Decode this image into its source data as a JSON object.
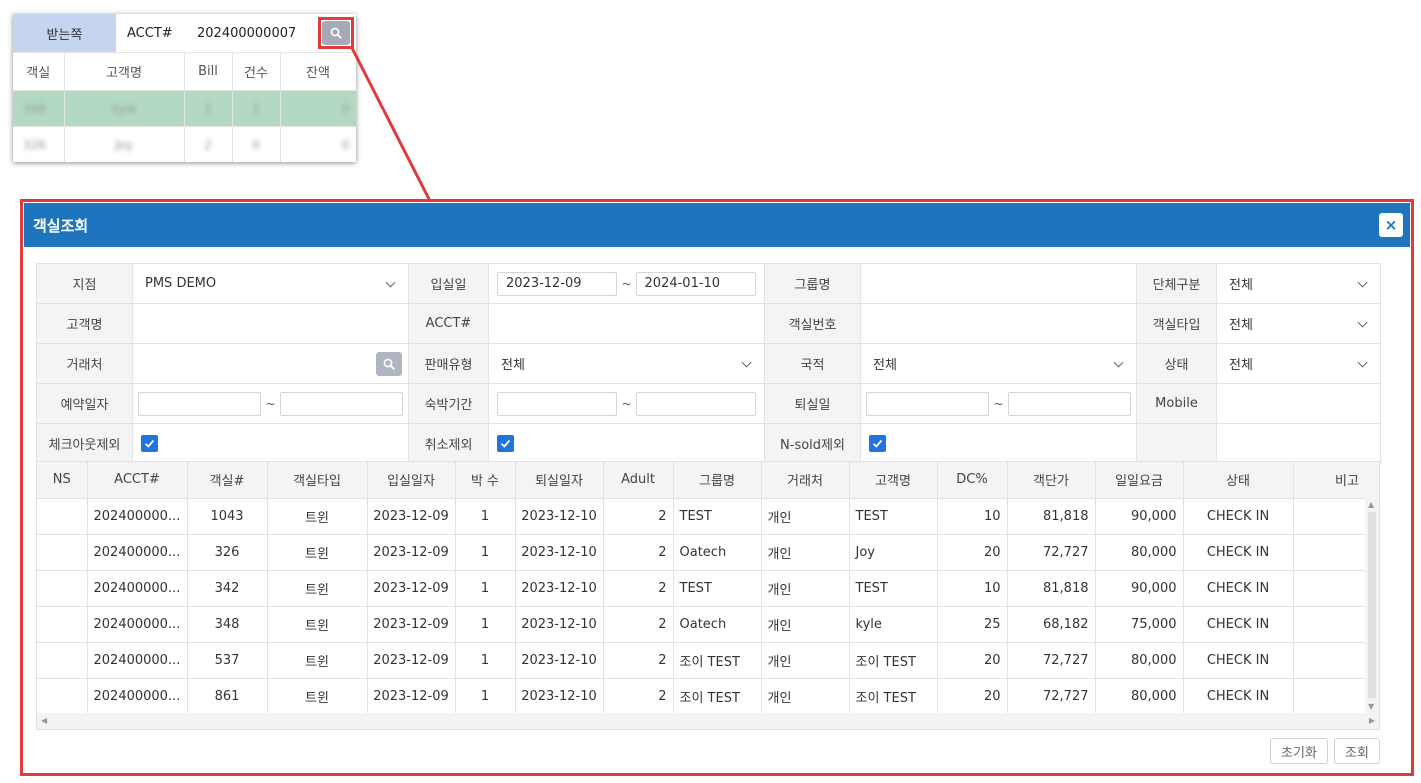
{
  "snippet": {
    "recv_label": "받는쪽",
    "acct_label": "ACCT#",
    "acct_value": "202400000007",
    "columns": [
      "객실",
      "고객명",
      "Bill",
      "건수",
      "잔액"
    ],
    "rows": [
      {
        "room": "348",
        "guest": "kyle",
        "bill": "1",
        "count": "2",
        "balance": "0"
      },
      {
        "room": "326",
        "guest": "Joy",
        "bill": "2",
        "count": "0",
        "balance": "0"
      }
    ]
  },
  "dialog": {
    "title": "객실조회",
    "close": "×"
  },
  "filters": {
    "branch_label": "지점",
    "branch_value": "PMS DEMO",
    "checkin_label": "입실일",
    "checkin_from": "2023-12-09",
    "checkin_to": "2024-01-10",
    "group_label": "그룹명",
    "grouptype_label": "단체구분",
    "grouptype_value": "전체",
    "guest_label": "고객명",
    "acct_label": "ACCT#",
    "roomno_label": "객실번호",
    "roomtype_label": "객실타입",
    "roomtype_value": "전체",
    "client_label": "거래처",
    "saletype_label": "판매유형",
    "saletype_value": "전체",
    "nation_label": "국적",
    "nation_value": "전체",
    "status_label": "상태",
    "status_value": "전체",
    "resdate_label": "예약일자",
    "stay_label": "숙박기간",
    "checkout_label": "퇴실일",
    "mobile_label": "Mobile",
    "excl_checkout_label": "체크아웃제외",
    "excl_cancel_label": "취소제외",
    "excl_nsold_label": "N-sold제외",
    "tilde": "~"
  },
  "grid": {
    "columns": [
      "NS",
      "ACCT#",
      "객실#",
      "객실타입",
      "입실일자",
      "박 수",
      "퇴실일자",
      "Adult",
      "그룹명",
      "거래처",
      "고객명",
      "DC%",
      "객단가",
      "일일요금",
      "상태",
      "비고"
    ],
    "rows": [
      {
        "ns": "",
        "acct": "202400000...",
        "room": "1043",
        "type": "트윈",
        "in": "2023-12-09",
        "nights": "1",
        "out": "2023-12-10",
        "adult": "2",
        "group": "TEST",
        "client": "개인",
        "guest": "TEST",
        "dc": "10",
        "unit": "81,818",
        "daily": "90,000",
        "status": "CHECK IN",
        "note": ""
      },
      {
        "ns": "",
        "acct": "202400000...",
        "room": "326",
        "type": "트윈",
        "in": "2023-12-09",
        "nights": "1",
        "out": "2023-12-10",
        "adult": "2",
        "group": "Oatech",
        "client": "개인",
        "guest": "Joy",
        "dc": "20",
        "unit": "72,727",
        "daily": "80,000",
        "status": "CHECK IN",
        "note": ""
      },
      {
        "ns": "",
        "acct": "202400000...",
        "room": "342",
        "type": "트윈",
        "in": "2023-12-09",
        "nights": "1",
        "out": "2023-12-10",
        "adult": "2",
        "group": "TEST",
        "client": "개인",
        "guest": "TEST",
        "dc": "10",
        "unit": "81,818",
        "daily": "90,000",
        "status": "CHECK IN",
        "note": ""
      },
      {
        "ns": "",
        "acct": "202400000...",
        "room": "348",
        "type": "트윈",
        "in": "2023-12-09",
        "nights": "1",
        "out": "2023-12-10",
        "adult": "2",
        "group": "Oatech",
        "client": "개인",
        "guest": "kyle",
        "dc": "25",
        "unit": "68,182",
        "daily": "75,000",
        "status": "CHECK IN",
        "note": ""
      },
      {
        "ns": "",
        "acct": "202400000...",
        "room": "537",
        "type": "트윈",
        "in": "2023-12-09",
        "nights": "1",
        "out": "2023-12-10",
        "adult": "2",
        "group": "조이 TEST",
        "client": "개인",
        "guest": "조이 TEST",
        "dc": "20",
        "unit": "72,727",
        "daily": "80,000",
        "status": "CHECK IN",
        "note": ""
      },
      {
        "ns": "",
        "acct": "202400000...",
        "room": "861",
        "type": "트윈",
        "in": "2023-12-09",
        "nights": "1",
        "out": "2023-12-10",
        "adult": "2",
        "group": "조이 TEST",
        "client": "개인",
        "guest": "조이 TEST",
        "dc": "20",
        "unit": "72,727",
        "daily": "80,000",
        "status": "CHECK IN",
        "note": ""
      }
    ]
  },
  "buttons": {
    "reset": "초기화",
    "search": "조회"
  },
  "colors": {
    "header_blue": "#1e74bd",
    "highlight_red": "#e03a3a",
    "selected_row": "#b3d9c2",
    "checkbox_blue": "#1f74e0"
  },
  "icons": {
    "search": "search-icon",
    "close": "close-icon",
    "dropdown": "chevron-down-icon",
    "check": "checkmark-icon"
  }
}
